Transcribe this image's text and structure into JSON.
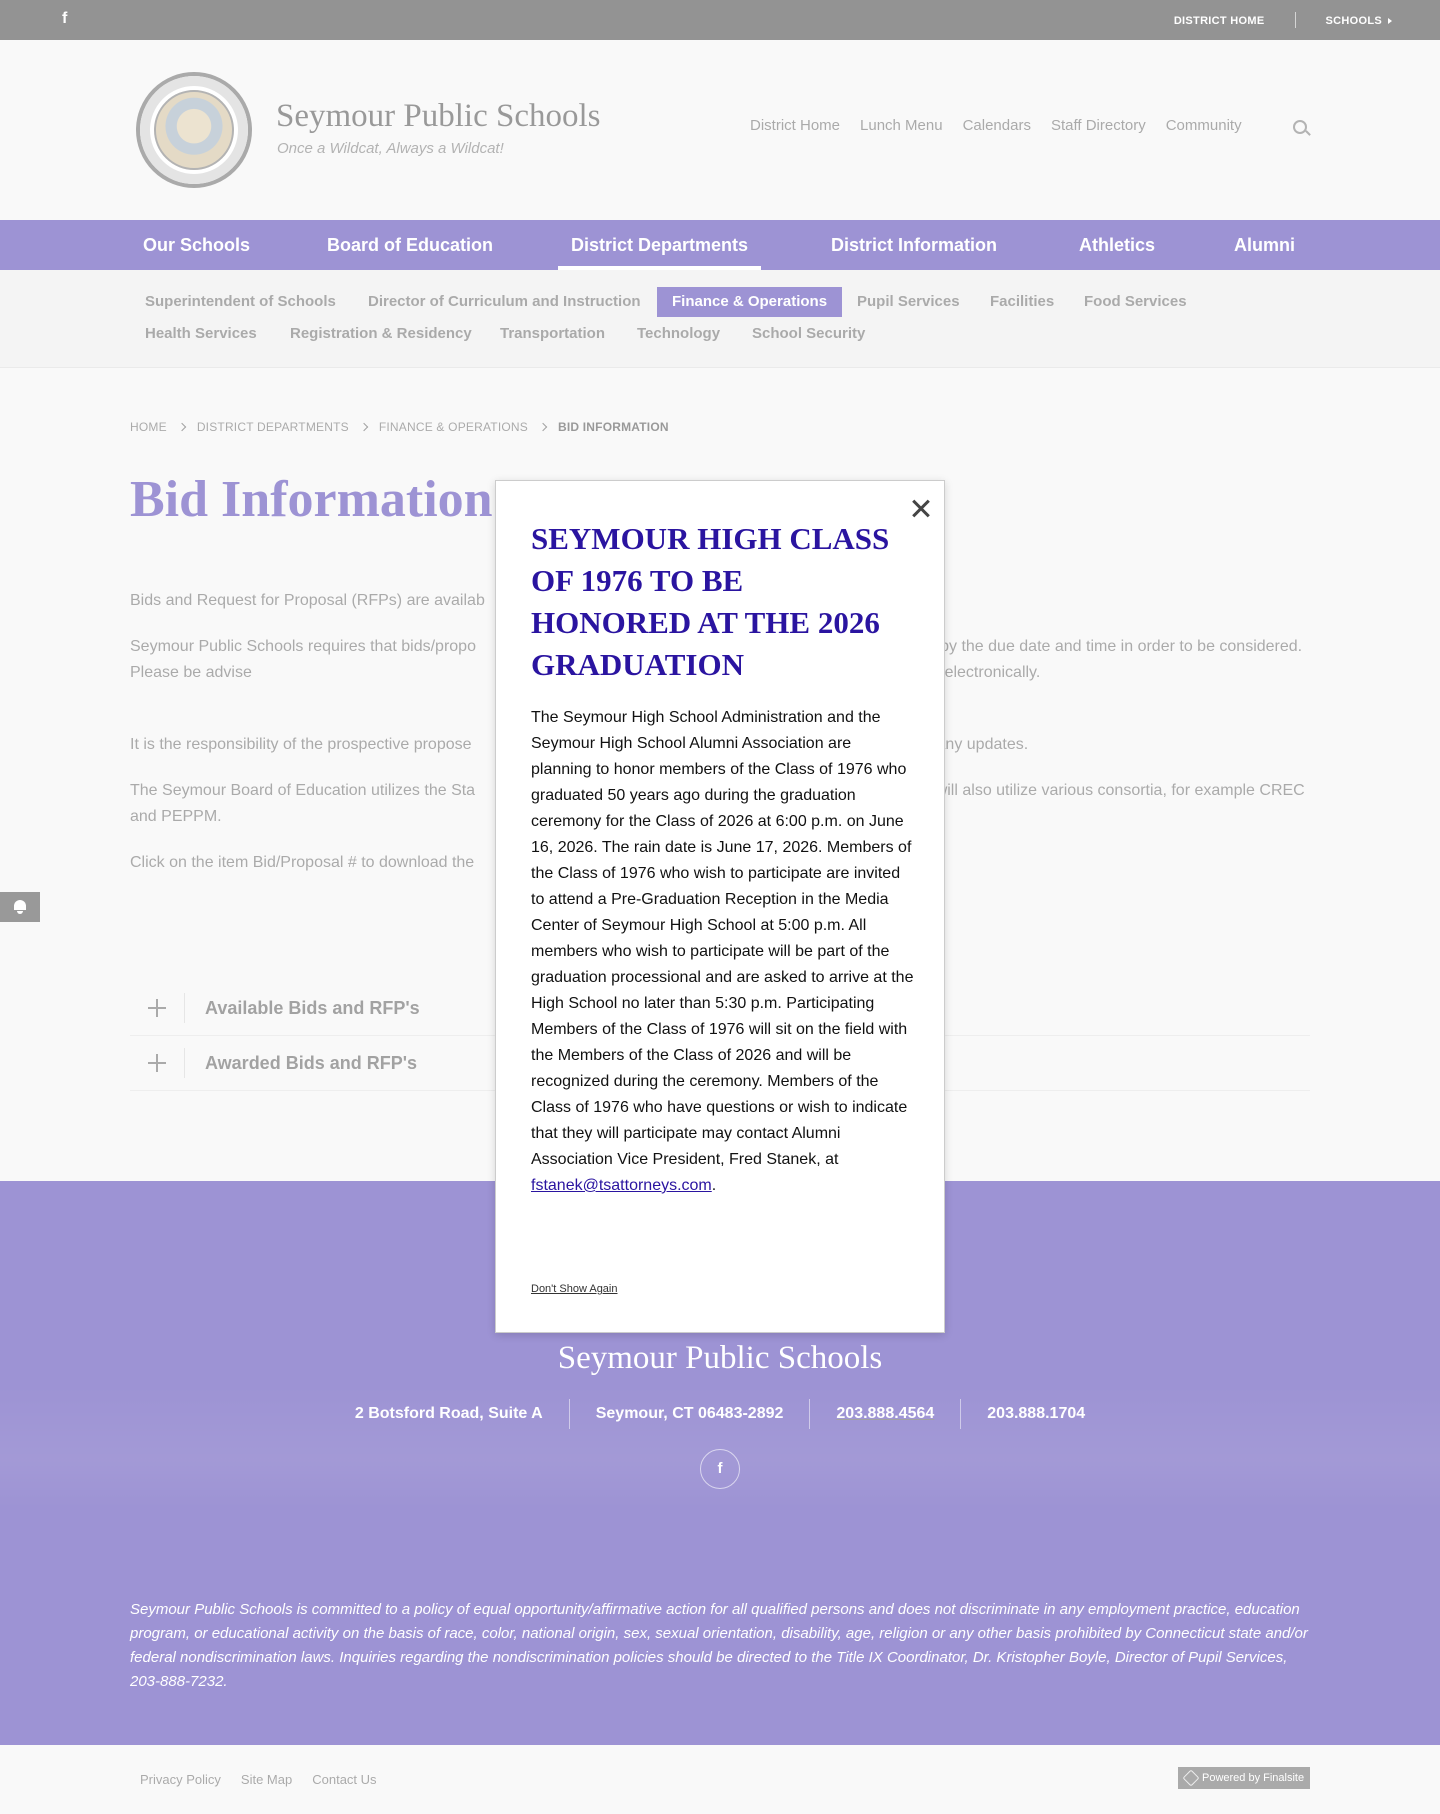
{
  "topbar": {
    "facebook_icon": "facebook-icon",
    "district_home": "DISTRICT HOME",
    "schools": "SCHOOLS"
  },
  "header": {
    "title": "Seymour Public Schools",
    "tagline": "Once a Wildcat, Always a Wildcat!",
    "util_nav": [
      "District Home",
      "Lunch Menu",
      "Calendars",
      "Staff Directory",
      "Community"
    ]
  },
  "main_nav": [
    "Our Schools",
    "Board of Education",
    "District Departments",
    "District Information",
    "Athletics",
    "Alumni"
  ],
  "sub_nav": [
    "Superintendent of Schools",
    "Director of Curriculum and Instruction",
    "Finance & Operations",
    "Pupil Services",
    "Facilities",
    "Food Services",
    "Health Services",
    "Registration & Residency",
    "Transportation",
    "Technology",
    "School Security"
  ],
  "breadcrumb": [
    "HOME",
    "DISTRICT DEPARTMENTS",
    "FINANCE & OPERATIONS",
    "BID INFORMATION"
  ],
  "page": {
    "title": "Bid Information",
    "paragraphs": [
      "Bids and Request for Proposal (RFPs) are availab",
      "Seymour Public Schools requires that bids/propo                                                               d Operations Department by the due date and time in order to be considered. Please be advise                                                               chools Finance and Operations Department may accept it electronically.",
      "It is the responsibility of the prospective propose                                                               ) to check this website for any updates.",
      "The Seymour Board of Education utilizes the Sta                                                               d List as appropriate and will also utilize various consortia, for example CREC and PEPPM.",
      "Click on the item Bid/Proposal # to download the"
    ],
    "accordions": [
      "Available Bids and RFP's",
      "Awarded Bids and RFP's"
    ]
  },
  "footer": {
    "title": "Seymour Public Schools",
    "address": "2 Botsford Road, Suite A",
    "city": "Seymour, CT  06483-2892",
    "phone": "203.888.4564",
    "fax": "203.888.1704",
    "disclaimer": "Seymour Public Schools is committed to a policy of equal opportunity/affirmative action for all qualified persons and does not discriminate in any employment practice, education program, or educational activity on the basis of race, color, national origin, sex, sexual orientation, disability, age, religion or any other basis prohibited by Connecticut state and/or federal nondiscrimination laws.  Inquiries regarding the nondiscrimination policies should be directed to the Title IX Coordinator, Dr. Kristopher Boyle, Director of Pupil Services, 203-888-7232.",
    "links": [
      "Privacy Policy",
      "Site Map",
      "Contact Us"
    ],
    "powered": "Powered by Finalsite"
  },
  "modal": {
    "title": "SEYMOUR HIGH CLASS OF 1976 TO BE HONORED AT THE 2026 GRADUATION",
    "body": "The Seymour High School Administration and the Seymour High School Alumni Association are planning to honor members of the Class of 1976 who graduated 50 years ago during the graduation ceremony for the Class of 2026 at 6:00 p.m. on June 16, 2026. The rain date is June 17, 2026. Members of the Class of 1976 who wish to participate are invited to attend a Pre-Graduation Reception in the Media Center of Seymour High School at 5:00 p.m. All members who wish to participate will be part of the graduation processional and are asked to arrive at the High School no later than 5:30 p.m. Participating Members of the Class of 1976 will sit on the field with the Members of the Class of 2026 and will be recognized during the ceremony. Members of the Class of 1976 who have questions or wish to indicate that they will participate may contact Alumni Association Vice President, Fred Stanek, at ",
    "email": "fstanek@tsattorneys.com",
    "period": ".",
    "dont_show": "Don't Show Again"
  },
  "colors": {
    "brand": "#3a26a8",
    "modal_title": "#2a14a0",
    "topbar": "#262626"
  }
}
